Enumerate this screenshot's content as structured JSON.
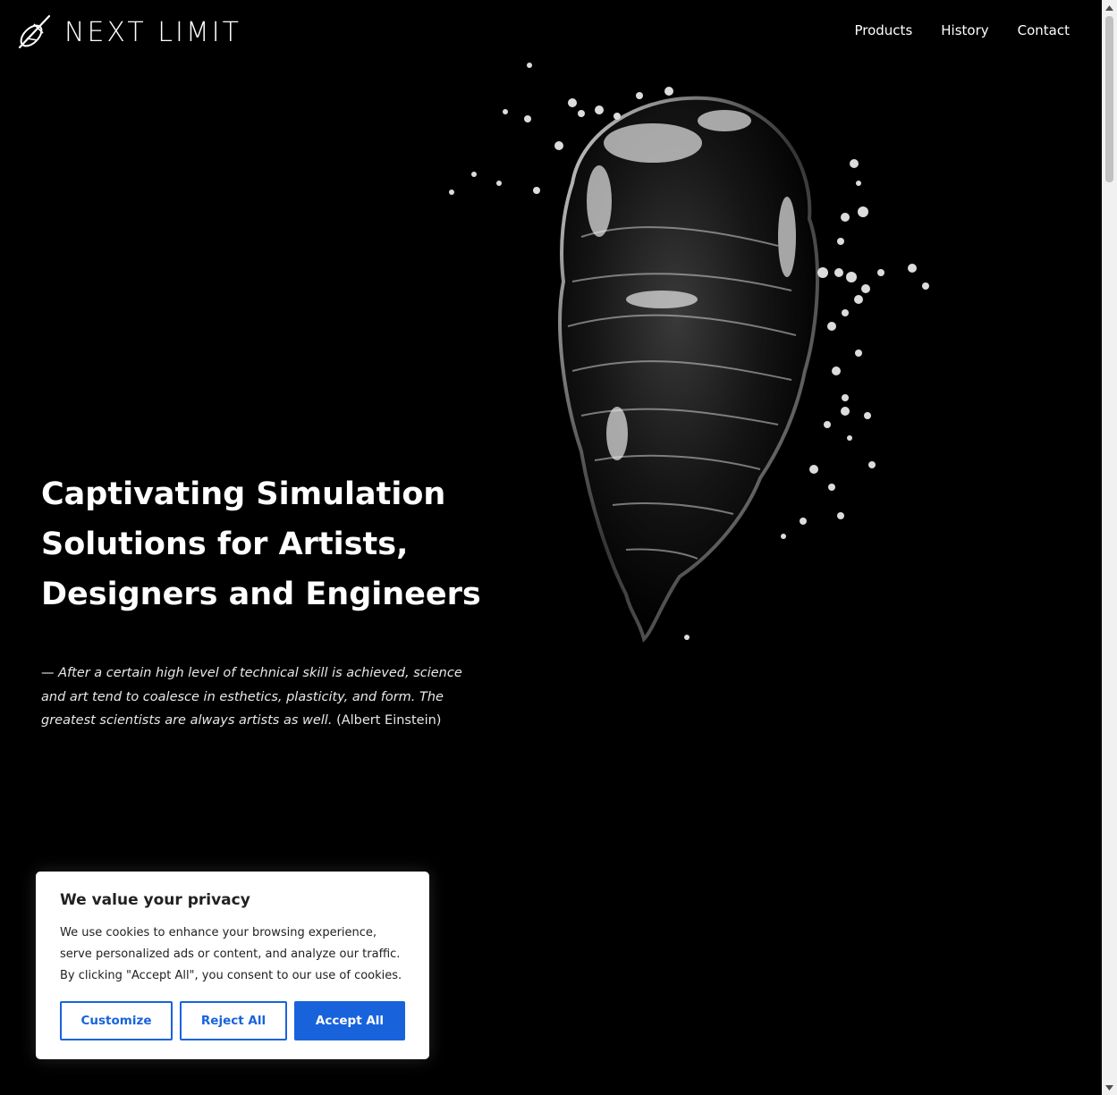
{
  "header": {
    "brand": "NEXT LIMIT",
    "logo_icon": "next-limit-logo-icon",
    "nav": [
      "Products",
      "History",
      "Contact"
    ]
  },
  "hero": {
    "image_alt": "liquid-water-face-icon",
    "headline_lines": [
      "Captivating Simulation",
      "Solutions for Artists,",
      "Designers and Engineers"
    ],
    "quote_dash": "—",
    "quote_text": "After a certain high level of technical skill is achieved, science and art tend to coalesce in esthetics, plasticity, and form. The greatest scientists are always artists as well.",
    "quote_author": "(Albert Einstein)"
  },
  "cookie_banner": {
    "title": "We value your privacy",
    "text": "We use cookies to enhance your browsing experience, serve personalized ads or content, and analyze our traffic. By clicking \"Accept All\", you consent to our use of cookies.",
    "buttons": {
      "customize": "Customize",
      "reject": "Reject All",
      "accept": "Accept All"
    },
    "accent_color": "#1863dc"
  },
  "colors": {
    "background": "#000000",
    "text": "#ffffff"
  }
}
